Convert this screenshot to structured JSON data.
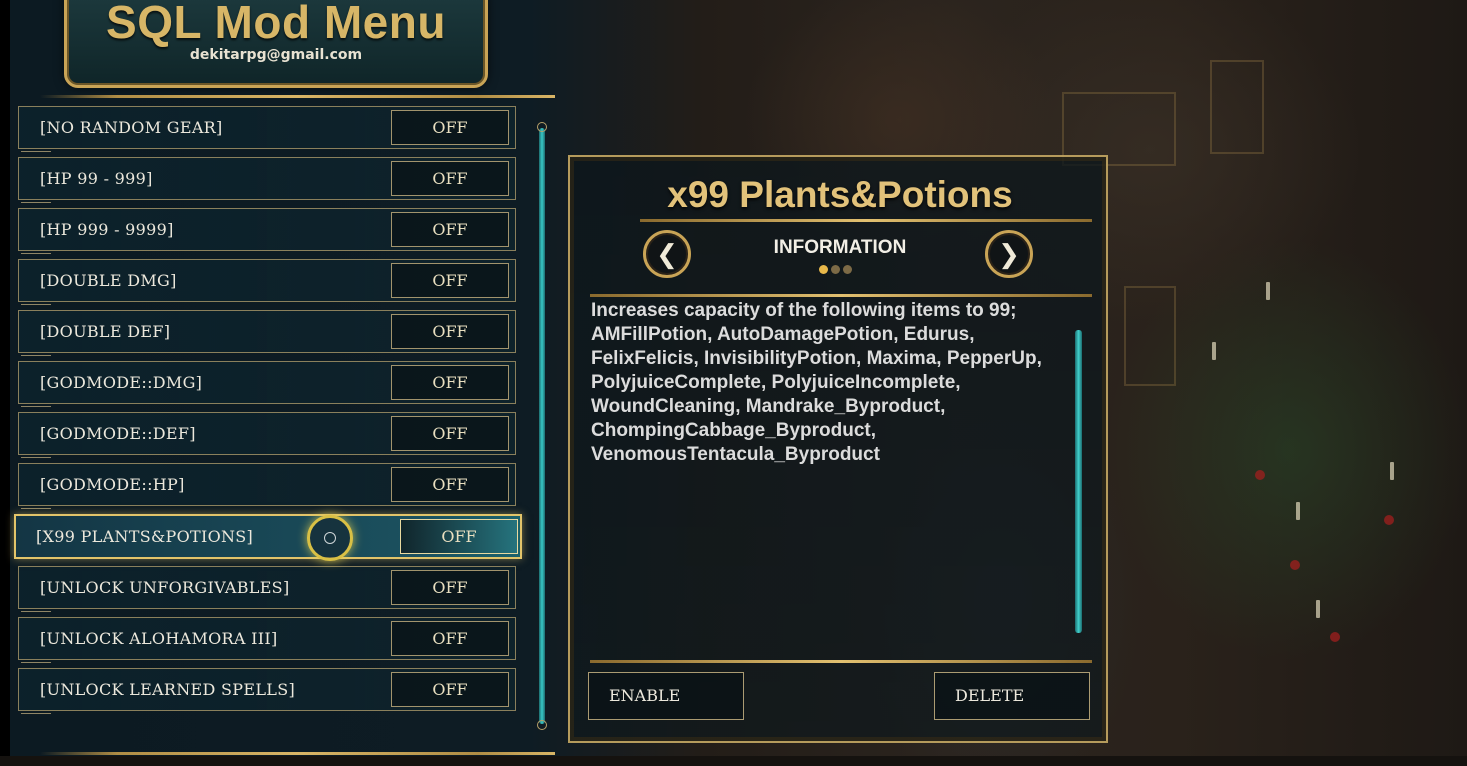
{
  "header": {
    "title": "SQL Mod Menu",
    "email": "dekitarpg@gmail.com"
  },
  "mods": [
    {
      "label": "[NO RANDOM GEAR]",
      "state": "OFF"
    },
    {
      "label": "[HP 99 - 999]",
      "state": "OFF"
    },
    {
      "label": "[HP 999 - 9999]",
      "state": "OFF"
    },
    {
      "label": "[DOUBLE DMG]",
      "state": "OFF"
    },
    {
      "label": "[DOUBLE DEF]",
      "state": "OFF"
    },
    {
      "label": "[GODMODE::DMG]",
      "state": "OFF"
    },
    {
      "label": "[GODMODE::DEF]",
      "state": "OFF"
    },
    {
      "label": "[GODMODE::HP]",
      "state": "OFF"
    },
    {
      "label": "[X99 PLANTS&POTIONS]",
      "state": "OFF",
      "selected": true
    },
    {
      "label": "[UNLOCK UNFORGIVABLES]",
      "state": "OFF"
    },
    {
      "label": "[UNLOCK ALOHAMORA III]",
      "state": "OFF"
    },
    {
      "label": "[UNLOCK LEARNED SPELLS]",
      "state": "OFF"
    }
  ],
  "info": {
    "title": "x99 Plants&Potions",
    "subtitle": "INFORMATION",
    "prev_glyph": "❮",
    "next_glyph": "❯",
    "page_dots": 3,
    "active_dot": 1,
    "description_lines": [
      "Increases capacity of the following items to 99;",
      "AMFillPotion, AutoDamagePotion, Edurus,",
      "FelixFelicis, InvisibilityPotion, Maxima, PepperUp,",
      "PolyjuiceComplete, PolyjuiceIncomplete,",
      "WoundCleaning, Mandrake_Byproduct,",
      "ChompingCabbage_Byproduct,",
      "VenomousTentacula_Byproduct"
    ],
    "enable_label": "ENABLE",
    "delete_label": "DELETE"
  },
  "colors": {
    "accent_gold": "#d7b667",
    "scroll_teal": "#38c7c6",
    "selected_border": "#e2c46a"
  }
}
